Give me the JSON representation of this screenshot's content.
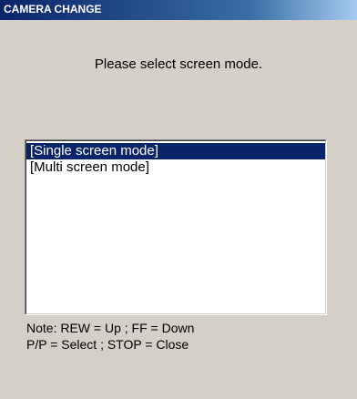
{
  "window": {
    "title": "CAMERA CHANGE"
  },
  "prompt": "Please select screen mode.",
  "listbox": {
    "items": [
      {
        "label": "[Single screen mode]",
        "selected": true
      },
      {
        "label": "[Multi screen mode]",
        "selected": false
      }
    ]
  },
  "notes": {
    "line1": "Note: REW = Up ; FF = Down",
    "line2": "P/P = Select ; STOP = Close"
  },
  "colors": {
    "title_bar": "#0a246a",
    "selection": "#0a246a",
    "dialog_bg": "#d4d0c8"
  }
}
